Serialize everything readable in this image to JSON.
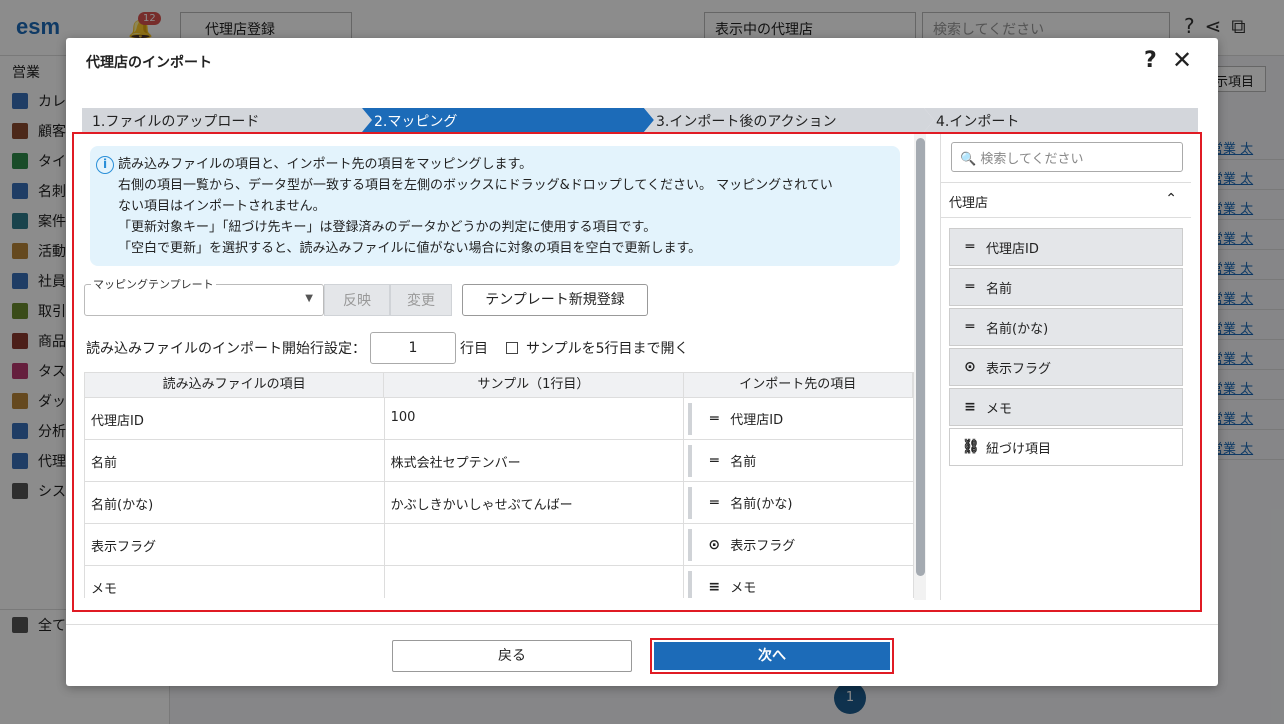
{
  "background": {
    "logo": "esm",
    "notification_count": "12",
    "top_select": "代理店登録",
    "view_select": "表示中の代理店",
    "search_placeholder": "検索してください",
    "column_button": "示項目",
    "user": "営業",
    "sidebar": [
      "カレ",
      "顧客",
      "タイ",
      "名刺",
      "案件",
      "活動",
      "社員",
      "取引",
      "商品",
      "タス",
      "ダッ",
      "分析",
      "代理",
      "シス"
    ],
    "sidebar_bottom": "全て",
    "table_col": [
      "営業 太",
      "営業 太",
      "営業 太",
      "営業 太",
      "営業 太",
      "営業 太",
      "営業 太",
      "営業 太",
      "営業 太",
      "営業 太",
      "営業 太"
    ],
    "pager_current": "1"
  },
  "modal": {
    "title": "代理店のインポート",
    "steps": [
      "1.ファイルのアップロード",
      "2.マッピング",
      "3.インポート後のアクション",
      "4.インポート"
    ],
    "info_lines": [
      "読み込みファイルの項目と、インポート先の項目をマッピングします。",
      "右側の項目一覧から、データ型が一致する項目を左側のボックスにドラッグ&ドロップしてください。 マッピングされてい",
      "ない項目はインポートされません。",
      "「更新対象キー」「紐づけ先キー」は登録済みのデータかどうかの判定に使用する項目です。",
      "「空白で更新」を選択すると、読み込みファイルに値がない場合に対象の項目を空白で更新します。"
    ],
    "template_label": "マッピングテンプレート",
    "btn_apply": "反映",
    "btn_change": "変更",
    "btn_new_template": "テンプレート新規登録",
    "start_row_label": "読み込みファイルのインポート開始行設定：",
    "start_row_value": "1",
    "start_row_unit": "行目",
    "sample_checkbox": "サンプルを5行目まで開く",
    "columns": [
      "読み込みファイルの項目",
      "サンプル（1行目）",
      "インポート先の項目"
    ],
    "rows": [
      {
        "source": "代理店ID",
        "sample": "100",
        "target": "代理店ID",
        "icon": "text"
      },
      {
        "source": "名前",
        "sample": "株式会社セプテンバー",
        "target": "名前",
        "icon": "text"
      },
      {
        "source": "名前(かな)",
        "sample": "かぶしきかいしゃせぷてんばー",
        "target": "名前(かな)",
        "icon": "text"
      },
      {
        "source": "表示フラグ",
        "sample": "",
        "target": "表示フラグ",
        "icon": "select"
      },
      {
        "source": "メモ",
        "sample": "",
        "target": "メモ",
        "icon": "memo"
      }
    ],
    "right_panel": {
      "search_placeholder": "検索してください",
      "group": "代理店",
      "items": [
        {
          "label": "代理店ID",
          "icon": "text"
        },
        {
          "label": "名前",
          "icon": "text"
        },
        {
          "label": "名前(かな)",
          "icon": "text"
        },
        {
          "label": "表示フラグ",
          "icon": "select"
        },
        {
          "label": "メモ",
          "icon": "memo"
        },
        {
          "label": "紐づけ項目",
          "icon": "link"
        }
      ]
    },
    "btn_back": "戻る",
    "btn_next": "次へ"
  },
  "colors": {
    "primary": "#1c6bb8",
    "highlight": "#e01b24",
    "info_bg": "#e3f3fc"
  }
}
